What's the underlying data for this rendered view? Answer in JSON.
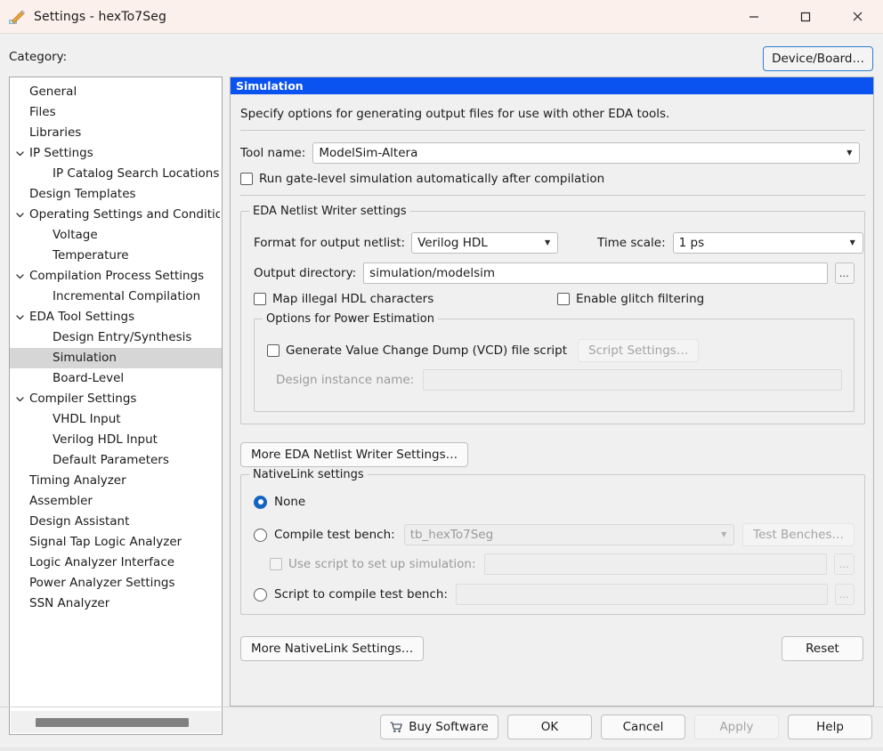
{
  "window": {
    "title": "Settings - hexTo7Seg",
    "icon": "pencil-icon",
    "minimize": "minimize-icon",
    "maximize": "maximize-icon",
    "close": "close-icon"
  },
  "category": {
    "label": "Category:",
    "device_board_button": "Device/Board…",
    "items": [
      {
        "label": "General",
        "level": 0,
        "expandable": false,
        "selected": false
      },
      {
        "label": "Files",
        "level": 0,
        "expandable": false,
        "selected": false
      },
      {
        "label": "Libraries",
        "level": 0,
        "expandable": false,
        "selected": false
      },
      {
        "label": "IP Settings",
        "level": 0,
        "expandable": true,
        "expanded": true,
        "selected": false
      },
      {
        "label": "IP Catalog Search Locations",
        "level": 1,
        "expandable": false,
        "selected": false
      },
      {
        "label": "Design Templates",
        "level": 0,
        "expandable": false,
        "selected": false
      },
      {
        "label": "Operating Settings and Conditions",
        "level": 0,
        "expandable": true,
        "expanded": true,
        "selected": false
      },
      {
        "label": "Voltage",
        "level": 1,
        "expandable": false,
        "selected": false
      },
      {
        "label": "Temperature",
        "level": 1,
        "expandable": false,
        "selected": false
      },
      {
        "label": "Compilation Process Settings",
        "level": 0,
        "expandable": true,
        "expanded": true,
        "selected": false
      },
      {
        "label": "Incremental Compilation",
        "level": 1,
        "expandable": false,
        "selected": false
      },
      {
        "label": "EDA Tool Settings",
        "level": 0,
        "expandable": true,
        "expanded": true,
        "selected": false
      },
      {
        "label": "Design Entry/Synthesis",
        "level": 1,
        "expandable": false,
        "selected": false
      },
      {
        "label": "Simulation",
        "level": 1,
        "expandable": false,
        "selected": true
      },
      {
        "label": "Board-Level",
        "level": 1,
        "expandable": false,
        "selected": false
      },
      {
        "label": "Compiler Settings",
        "level": 0,
        "expandable": true,
        "expanded": true,
        "selected": false
      },
      {
        "label": "VHDL Input",
        "level": 1,
        "expandable": false,
        "selected": false
      },
      {
        "label": "Verilog HDL Input",
        "level": 1,
        "expandable": false,
        "selected": false
      },
      {
        "label": "Default Parameters",
        "level": 1,
        "expandable": false,
        "selected": false
      },
      {
        "label": "Timing Analyzer",
        "level": 0,
        "expandable": false,
        "selected": false
      },
      {
        "label": "Assembler",
        "level": 0,
        "expandable": false,
        "selected": false
      },
      {
        "label": "Design Assistant",
        "level": 0,
        "expandable": false,
        "selected": false
      },
      {
        "label": "Signal Tap Logic Analyzer",
        "level": 0,
        "expandable": false,
        "selected": false
      },
      {
        "label": "Logic Analyzer Interface",
        "level": 0,
        "expandable": false,
        "selected": false
      },
      {
        "label": "Power Analyzer Settings",
        "level": 0,
        "expandable": false,
        "selected": false
      },
      {
        "label": "SSN Analyzer",
        "level": 0,
        "expandable": false,
        "selected": false
      }
    ]
  },
  "panel": {
    "header": "Simulation",
    "description": "Specify options for generating output files for use with other EDA tools.",
    "tool_name_label": "Tool name:",
    "tool_name_value": "ModelSim-Altera",
    "run_gate_level_label": "Run gate-level simulation automatically after compilation",
    "run_gate_level_checked": false,
    "netlist_group": {
      "title": "EDA Netlist Writer settings",
      "format_label": "Format for output netlist:",
      "format_value": "Verilog HDL",
      "timescale_label": "Time scale:",
      "timescale_value": "1 ps",
      "output_dir_label": "Output directory:",
      "output_dir_value": "simulation/modelsim",
      "browse_label": "…",
      "map_illegal_label": "Map illegal HDL characters",
      "map_illegal_checked": false,
      "glitch_label": "Enable glitch filtering",
      "glitch_checked": false,
      "power_group": {
        "title": "Options for Power Estimation",
        "vcd_label": "Generate Value Change Dump (VCD) file script",
        "vcd_checked": false,
        "script_settings_button": "Script Settings…",
        "design_instance_label": "Design instance name:",
        "design_instance_value": ""
      }
    },
    "more_eda_button": "More EDA Netlist Writer Settings…",
    "nativelink_group": {
      "title": "NativeLink settings",
      "none_label": "None",
      "compile_tb_label": "Compile test bench:",
      "compile_tb_value": "tb_hexTo7Seg",
      "test_benches_button": "Test Benches…",
      "use_script_label": "Use script to set up simulation:",
      "use_script_value": "",
      "use_script_checked": false,
      "script_compile_label": "Script to compile test bench:",
      "script_compile_value": "",
      "browse_label": "…",
      "selected_option": "None"
    },
    "more_nativelink_button": "More NativeLink Settings…",
    "reset_button": "Reset"
  },
  "footer": {
    "buy_software": "Buy Software",
    "buy_software_icon": "shopping-cart-icon",
    "ok": "OK",
    "cancel": "Cancel",
    "apply": "Apply",
    "apply_enabled": false,
    "help": "Help"
  },
  "colors": {
    "header_blue": "#0a53f0",
    "titlebar": "#fbf0ec",
    "selection": "#d6d6d6",
    "accent_radio": "#1565c0",
    "focus_border": "#2f7fd0"
  }
}
